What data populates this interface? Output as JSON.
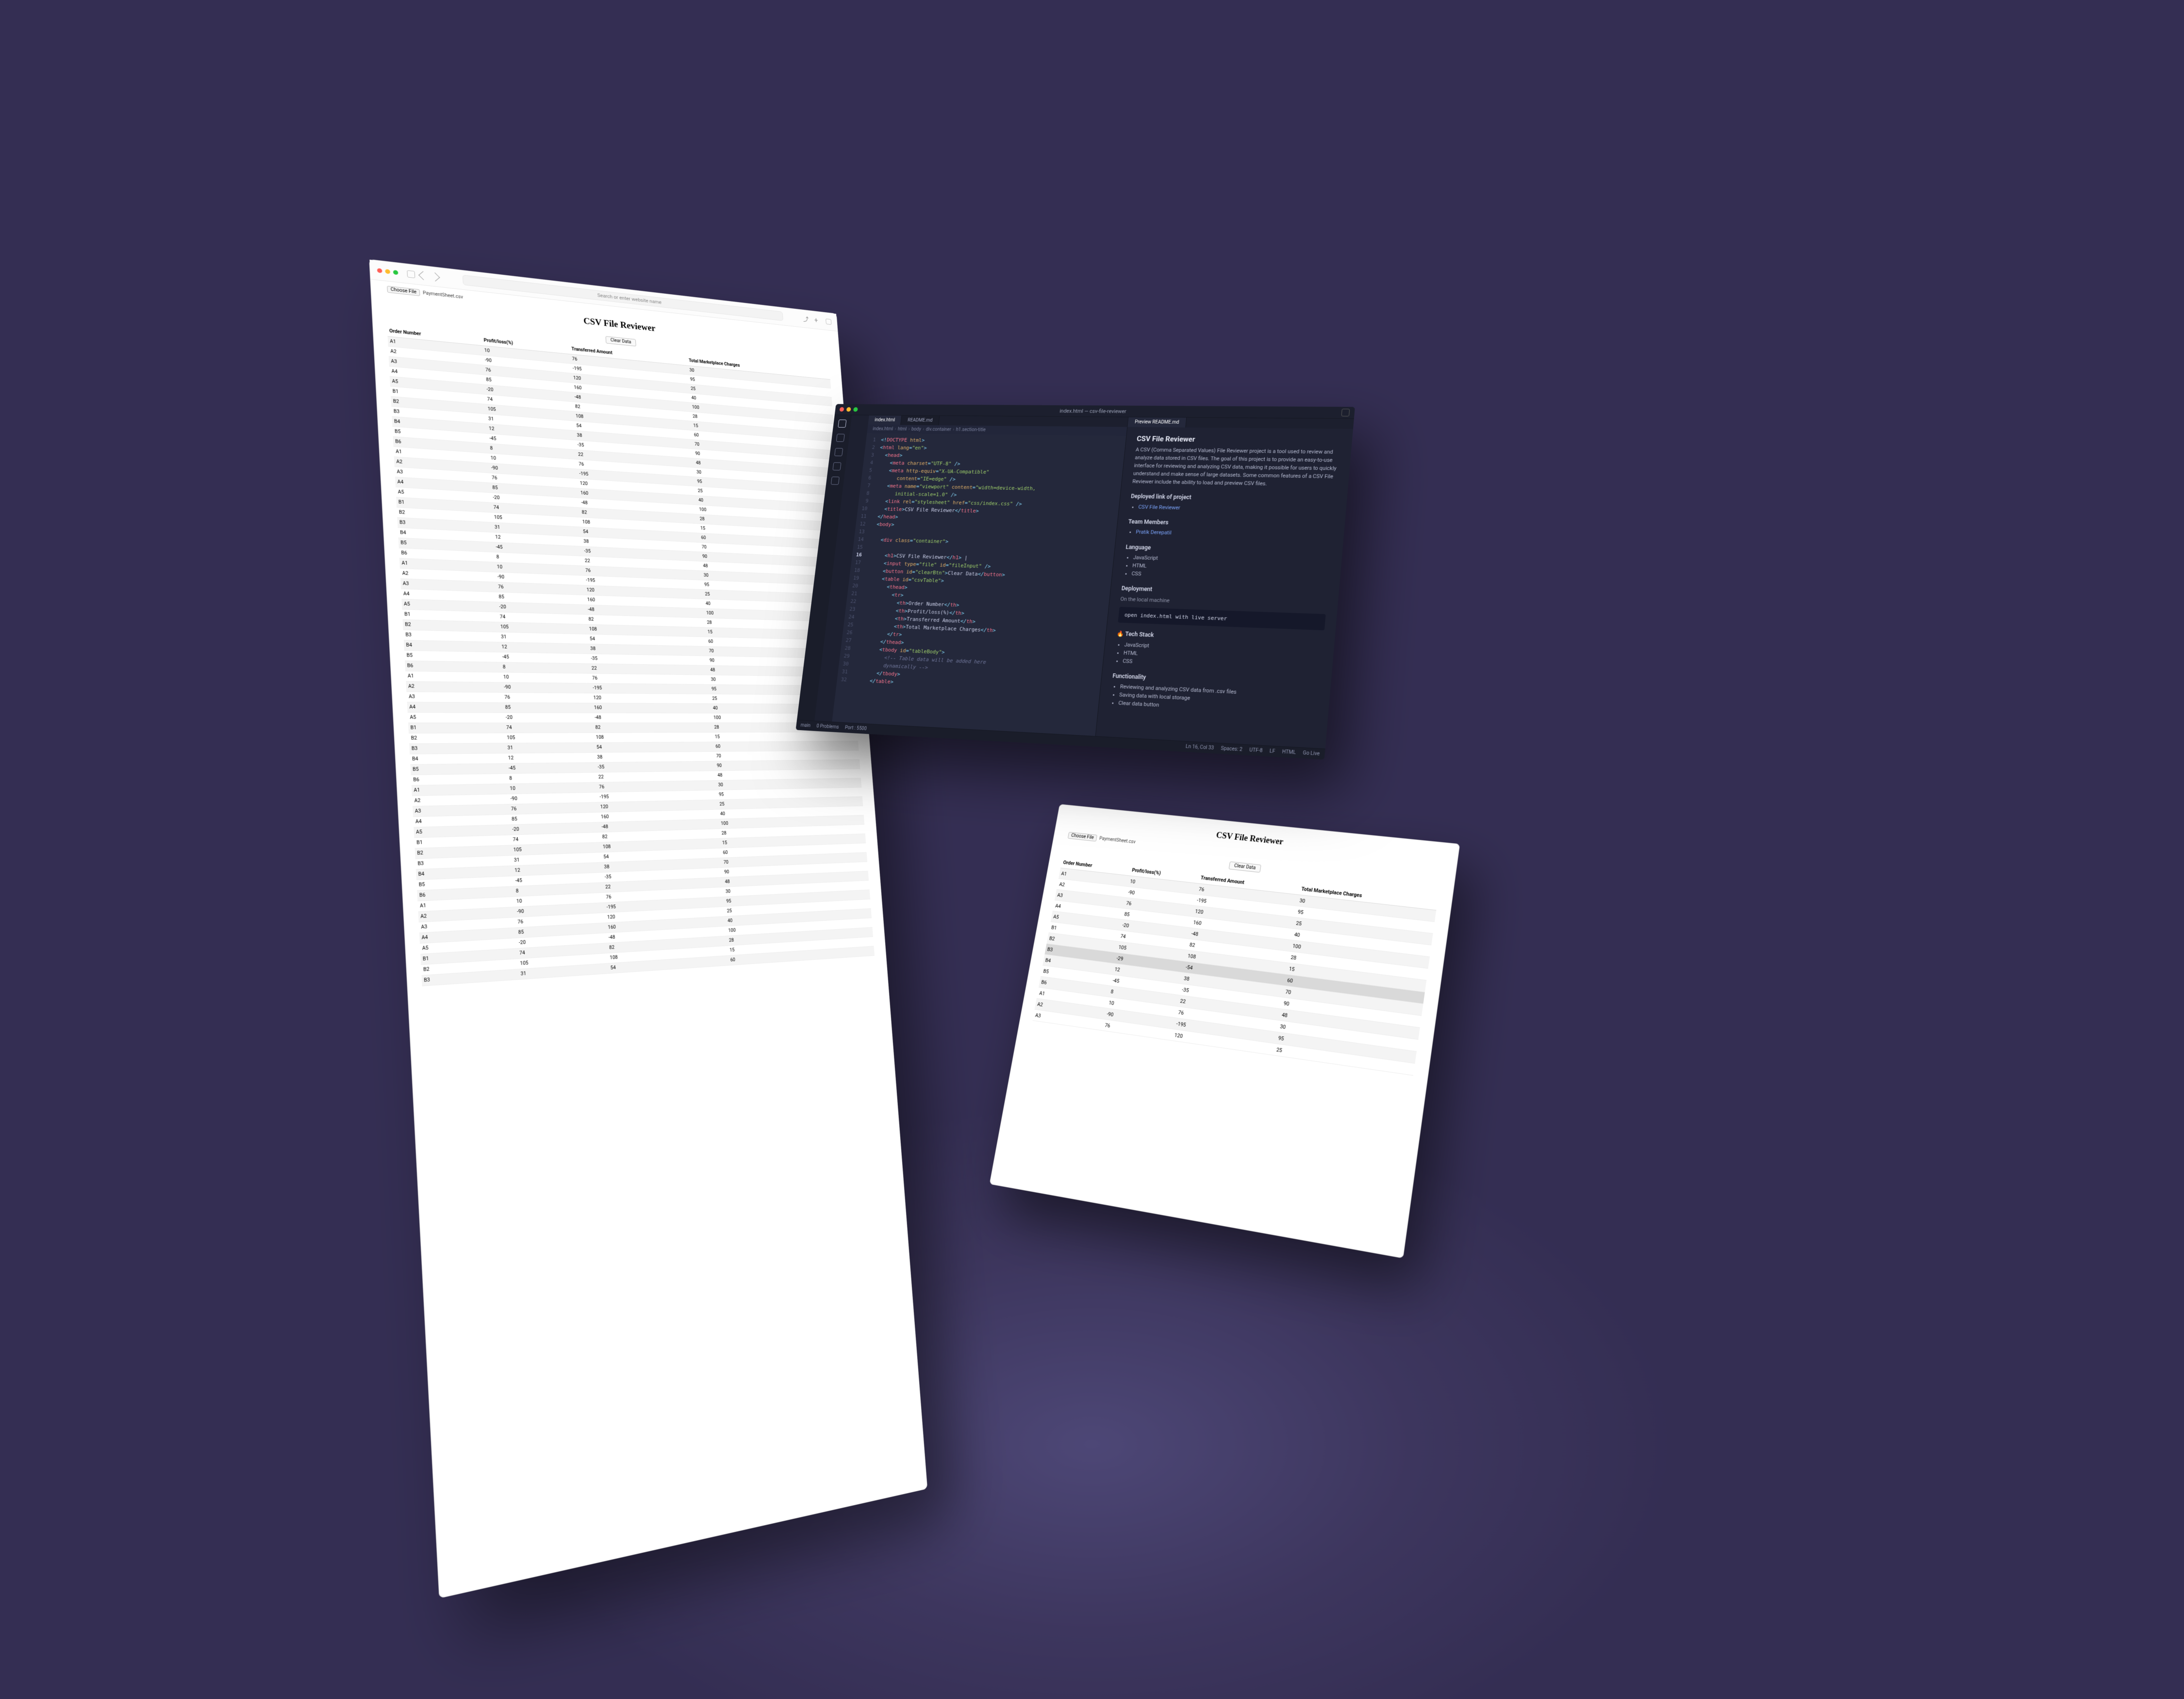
{
  "safari": {
    "address_placeholder": "Search or enter website name",
    "page_title": "CSV File Reviewer",
    "file_button": "Choose File",
    "file_name": "PaymentSheet.csv",
    "clear_button": "Clear Data",
    "columns": [
      "Order Number",
      "Profit/loss(%)",
      "Transferred Amount",
      "Total Marketplace Charges"
    ],
    "rows": [
      [
        "A1",
        "10",
        "76",
        "30"
      ],
      [
        "A2",
        "-90",
        "-195",
        "95"
      ],
      [
        "A3",
        "76",
        "120",
        "25"
      ],
      [
        "A4",
        "85",
        "160",
        "40"
      ],
      [
        "A5",
        "-20",
        "-48",
        "100"
      ],
      [
        "B1",
        "74",
        "82",
        "28"
      ],
      [
        "B2",
        "105",
        "108",
        "15"
      ],
      [
        "B3",
        "31",
        "54",
        "60"
      ],
      [
        "B4",
        "12",
        "38",
        "70"
      ],
      [
        "B5",
        "-45",
        "-35",
        "90"
      ],
      [
        "B6",
        "8",
        "22",
        "48"
      ],
      [
        "A1",
        "10",
        "76",
        "30"
      ],
      [
        "A2",
        "-90",
        "-195",
        "95"
      ],
      [
        "A3",
        "76",
        "120",
        "25"
      ],
      [
        "A4",
        "85",
        "160",
        "40"
      ],
      [
        "A5",
        "-20",
        "-48",
        "100"
      ],
      [
        "B1",
        "74",
        "82",
        "28"
      ],
      [
        "B2",
        "105",
        "108",
        "15"
      ],
      [
        "B3",
        "31",
        "54",
        "60"
      ],
      [
        "B4",
        "12",
        "38",
        "70"
      ],
      [
        "B5",
        "-45",
        "-35",
        "90"
      ],
      [
        "B6",
        "8",
        "22",
        "48"
      ],
      [
        "A1",
        "10",
        "76",
        "30"
      ],
      [
        "A2",
        "-90",
        "-195",
        "95"
      ],
      [
        "A3",
        "76",
        "120",
        "25"
      ],
      [
        "A4",
        "85",
        "160",
        "40"
      ],
      [
        "A5",
        "-20",
        "-48",
        "100"
      ],
      [
        "B1",
        "74",
        "82",
        "28"
      ],
      [
        "B2",
        "105",
        "108",
        "15"
      ],
      [
        "B3",
        "31",
        "54",
        "60"
      ],
      [
        "B4",
        "12",
        "38",
        "70"
      ],
      [
        "B5",
        "-45",
        "-35",
        "90"
      ],
      [
        "B6",
        "8",
        "22",
        "48"
      ],
      [
        "A1",
        "10",
        "76",
        "30"
      ],
      [
        "A2",
        "-90",
        "-195",
        "95"
      ],
      [
        "A3",
        "76",
        "120",
        "25"
      ],
      [
        "A4",
        "85",
        "160",
        "40"
      ],
      [
        "A5",
        "-20",
        "-48",
        "100"
      ],
      [
        "B1",
        "74",
        "82",
        "28"
      ],
      [
        "B2",
        "105",
        "108",
        "15"
      ],
      [
        "B3",
        "31",
        "54",
        "60"
      ],
      [
        "B4",
        "12",
        "38",
        "70"
      ],
      [
        "B5",
        "-45",
        "-35",
        "90"
      ],
      [
        "B6",
        "8",
        "22",
        "48"
      ],
      [
        "A1",
        "10",
        "76",
        "30"
      ],
      [
        "A2",
        "-90",
        "-195",
        "95"
      ],
      [
        "A3",
        "76",
        "120",
        "25"
      ],
      [
        "A4",
        "85",
        "160",
        "40"
      ],
      [
        "A5",
        "-20",
        "-48",
        "100"
      ],
      [
        "B1",
        "74",
        "82",
        "28"
      ],
      [
        "B2",
        "105",
        "108",
        "15"
      ],
      [
        "B3",
        "31",
        "54",
        "60"
      ],
      [
        "B4",
        "12",
        "38",
        "70"
      ],
      [
        "B5",
        "-45",
        "-35",
        "90"
      ],
      [
        "B6",
        "8",
        "22",
        "48"
      ],
      [
        "A1",
        "10",
        "76",
        "30"
      ],
      [
        "A2",
        "-90",
        "-195",
        "95"
      ],
      [
        "A3",
        "76",
        "120",
        "25"
      ],
      [
        "A4",
        "85",
        "160",
        "40"
      ],
      [
        "A5",
        "-20",
        "-48",
        "100"
      ],
      [
        "B1",
        "74",
        "82",
        "28"
      ],
      [
        "B2",
        "105",
        "108",
        "15"
      ],
      [
        "B3",
        "31",
        "54",
        "60"
      ]
    ]
  },
  "vscode": {
    "window_title": "index.html — csv-file-reviewer",
    "tabs": [
      "index.html",
      "README.md"
    ],
    "breadcrumbs": [
      "index.html",
      "html",
      "body",
      "div.container",
      "h1.section-title"
    ],
    "preview_tab": "Preview README.md",
    "gutter_highlight_line": "16",
    "code_lines": [
      {
        "n": "1",
        "html": "<span class='t-punc'>&lt;!</span><span class='t-tag'>DOCTYPE</span> <span class='t-attr'>html</span><span class='t-punc'>&gt;</span>"
      },
      {
        "n": "2",
        "html": "<span class='t-punc'>&lt;</span><span class='t-tag'>html</span> <span class='t-attr'>lang</span><span class='t-punc'>=</span><span class='t-str'>\"en\"</span><span class='t-punc'>&gt;</span>"
      },
      {
        "n": "3",
        "html": "  <span class='t-punc'>&lt;</span><span class='t-tag'>head</span><span class='t-punc'>&gt;</span>"
      },
      {
        "n": "4",
        "html": "    <span class='t-punc'>&lt;</span><span class='t-tag'>meta</span> <span class='t-attr'>charset</span><span class='t-punc'>=</span><span class='t-str'>\"UTF-8\"</span> <span class='t-punc'>/&gt;</span>"
      },
      {
        "n": "5",
        "html": "    <span class='t-punc'>&lt;</span><span class='t-tag'>meta</span> <span class='t-attr'>http-equiv</span><span class='t-punc'>=</span><span class='t-str'>\"X-UA-Compatible\"</span>"
      },
      {
        "n": "6",
        "html": "       <span class='t-attr'>content</span><span class='t-punc'>=</span><span class='t-str'>\"IE=edge\"</span> <span class='t-punc'>/&gt;</span>"
      },
      {
        "n": "7",
        "html": "    <span class='t-punc'>&lt;</span><span class='t-tag'>meta</span> <span class='t-attr'>name</span><span class='t-punc'>=</span><span class='t-str'>\"viewport\"</span> <span class='t-attr'>content</span><span class='t-punc'>=</span><span class='t-str'>\"width=device-width,</span>"
      },
      {
        "n": "8",
        "html": "       <span class='t-str'>initial-scale=1.0\"</span> <span class='t-punc'>/&gt;</span>"
      },
      {
        "n": "9",
        "html": "    <span class='t-punc'>&lt;</span><span class='t-tag'>link</span> <span class='t-attr'>rel</span><span class='t-punc'>=</span><span class='t-str'>\"stylesheet\"</span> <span class='t-attr'>href</span><span class='t-punc'>=</span><span class='t-str'>\"css/index.css\"</span> <span class='t-punc'>/&gt;</span>"
      },
      {
        "n": "10",
        "html": "    <span class='t-punc'>&lt;</span><span class='t-tag'>title</span><span class='t-punc'>&gt;</span>CSV File Reviewer<span class='t-punc'>&lt;/</span><span class='t-tag'>title</span><span class='t-punc'>&gt;</span>"
      },
      {
        "n": "11",
        "html": "  <span class='t-punc'>&lt;/</span><span class='t-tag'>head</span><span class='t-punc'>&gt;</span>"
      },
      {
        "n": "12",
        "html": "  <span class='t-punc'>&lt;</span><span class='t-tag'>body</span><span class='t-punc'>&gt;</span>"
      },
      {
        "n": "13",
        "html": ""
      },
      {
        "n": "14",
        "html": "    <span class='t-punc'>&lt;</span><span class='t-tag'>div</span> <span class='t-attr'>class</span><span class='t-punc'>=</span><span class='t-str'>\"container\"</span><span class='t-punc'>&gt;</span>"
      },
      {
        "n": "15",
        "html": ""
      },
      {
        "n": "16",
        "html": "      <span class='t-punc'>&lt;</span><span class='t-tag'>h1</span><span class='t-punc'>&gt;</span>CSV File Reviewer<span class='t-punc'>&lt;/</span><span class='t-tag'>h1</span><span class='t-punc'>&gt;</span> |"
      },
      {
        "n": "17",
        "html": "      <span class='t-punc'>&lt;</span><span class='t-tag'>input</span> <span class='t-attr'>type</span><span class='t-punc'>=</span><span class='t-str'>\"file\"</span> <span class='t-attr'>id</span><span class='t-punc'>=</span><span class='t-str'>\"fileInput\"</span> <span class='t-punc'>/&gt;</span>"
      },
      {
        "n": "18",
        "html": "      <span class='t-punc'>&lt;</span><span class='t-tag'>button</span> <span class='t-attr'>id</span><span class='t-punc'>=</span><span class='t-str'>\"clearBtn\"</span><span class='t-punc'>&gt;</span>Clear Data<span class='t-punc'>&lt;/</span><span class='t-tag'>button</span><span class='t-punc'>&gt;</span>"
      },
      {
        "n": "19",
        "html": "      <span class='t-punc'>&lt;</span><span class='t-tag'>table</span> <span class='t-attr'>id</span><span class='t-punc'>=</span><span class='t-str'>\"csvTable\"</span><span class='t-punc'>&gt;</span>"
      },
      {
        "n": "20",
        "html": "        <span class='t-punc'>&lt;</span><span class='t-tag'>thead</span><span class='t-punc'>&gt;</span>"
      },
      {
        "n": "21",
        "html": "          <span class='t-punc'>&lt;</span><span class='t-tag'>tr</span><span class='t-punc'>&gt;</span>"
      },
      {
        "n": "22",
        "html": "            <span class='t-punc'>&lt;</span><span class='t-tag'>th</span><span class='t-punc'>&gt;</span>Order Number<span class='t-punc'>&lt;/</span><span class='t-tag'>th</span><span class='t-punc'>&gt;</span>"
      },
      {
        "n": "23",
        "html": "            <span class='t-punc'>&lt;</span><span class='t-tag'>th</span><span class='t-punc'>&gt;</span>Profit/loss(%)<span class='t-punc'>&lt;/</span><span class='t-tag'>th</span><span class='t-punc'>&gt;</span>"
      },
      {
        "n": "24",
        "html": "            <span class='t-punc'>&lt;</span><span class='t-tag'>th</span><span class='t-punc'>&gt;</span>Transferred Amount<span class='t-punc'>&lt;/</span><span class='t-tag'>th</span><span class='t-punc'>&gt;</span>"
      },
      {
        "n": "25",
        "html": "            <span class='t-punc'>&lt;</span><span class='t-tag'>th</span><span class='t-punc'>&gt;</span>Total Marketplace Charges<span class='t-punc'>&lt;/</span><span class='t-tag'>th</span><span class='t-punc'>&gt;</span>"
      },
      {
        "n": "26",
        "html": "          <span class='t-punc'>&lt;/</span><span class='t-tag'>tr</span><span class='t-punc'>&gt;</span>"
      },
      {
        "n": "27",
        "html": "        <span class='t-punc'>&lt;/</span><span class='t-tag'>thead</span><span class='t-punc'>&gt;</span>"
      },
      {
        "n": "28",
        "html": "        <span class='t-punc'>&lt;</span><span class='t-tag'>tbody</span> <span class='t-attr'>id</span><span class='t-punc'>=</span><span class='t-str'>\"tableBody\"</span><span class='t-punc'>&gt;</span>"
      },
      {
        "n": "29",
        "html": "          <span class='t-comment'>&lt;!-- Table data will be added here</span>"
      },
      {
        "n": "30",
        "html": "          <span class='t-comment'>dynamically --&gt;</span>"
      },
      {
        "n": "31",
        "html": "        <span class='t-punc'>&lt;/</span><span class='t-tag'>tbody</span><span class='t-punc'>&gt;</span>"
      },
      {
        "n": "32",
        "html": "      <span class='t-punc'>&lt;/</span><span class='t-tag'>table</span><span class='t-punc'>&gt;</span>"
      }
    ],
    "readme": {
      "title": "CSV File Reviewer",
      "intro": "A CSV (Comma Separated Values) File Reviewer project is a tool used to review and analyze data stored in CSV files. The goal of this project is to provide an easy-to-use interface for reviewing and analyzing CSV data, making it possible for users to quickly understand and make sense of large datasets. Some common features of a CSV File Reviewer include the ability to load and preview CSV files.",
      "deployed_head": "Deployed link of project",
      "deployed_link": "CSV File Reviewer",
      "team_head": "Team Members",
      "team_link": "Pratik Derepatil",
      "lang_head": "Language",
      "langs": [
        "JavaScript",
        "HTML",
        "CSS"
      ],
      "deploy_head": "Deployment",
      "deploy_caption": "On the local machine",
      "deploy_code": "open index.html with live server",
      "stack_head": "🔥 Tech Stack",
      "stack": [
        "JavaScript",
        "HTML",
        "CSS"
      ],
      "func_head": "Functionality",
      "funcs": [
        "Reviewing and analyzing CSV data from .csv files",
        "Saving data with local storage",
        "Clear data button"
      ]
    },
    "status_left": [
      "main",
      "0 Problems",
      "Port : 5500"
    ],
    "status_right": [
      "Ln 16, Col 33",
      "Spaces: 2",
      "UTF-8",
      "LF",
      "HTML",
      "Go Live"
    ]
  },
  "small": {
    "page_title": "CSV File Reviewer",
    "file_button": "Choose File",
    "file_name": "PaymentSheet.csv",
    "clear_button": "Clear Data",
    "columns": [
      "Order Number",
      "Profit/loss(%)",
      "Transferred Amount",
      "Total Marketplace Charges"
    ],
    "highlight_index": 7,
    "rows": [
      [
        "A1",
        "10",
        "76",
        "30"
      ],
      [
        "A2",
        "-90",
        "-195",
        "95"
      ],
      [
        "A3",
        "76",
        "120",
        "25"
      ],
      [
        "A4",
        "85",
        "160",
        "40"
      ],
      [
        "A5",
        "-20",
        "-48",
        "100"
      ],
      [
        "B1",
        "74",
        "82",
        "28"
      ],
      [
        "B2",
        "105",
        "108",
        "15"
      ],
      [
        "B3",
        "-29",
        "-54",
        "60"
      ],
      [
        "B4",
        "12",
        "38",
        "70"
      ],
      [
        "B5",
        "-45",
        "-35",
        "90"
      ],
      [
        "B6",
        "8",
        "22",
        "48"
      ],
      [
        "A1",
        "10",
        "76",
        "30"
      ],
      [
        "A2",
        "-90",
        "-195",
        "95"
      ],
      [
        "A3",
        "76",
        "120",
        "25"
      ]
    ]
  }
}
